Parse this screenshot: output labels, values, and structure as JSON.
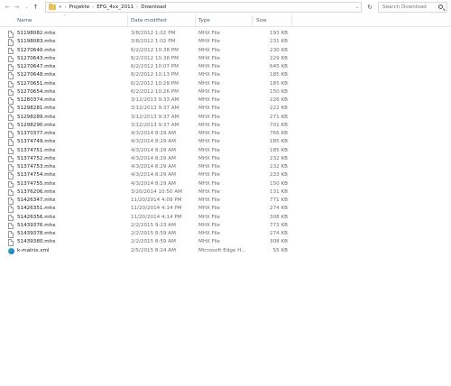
{
  "toolbar": {
    "back_icon": "arrow-left-icon",
    "forward_icon": "arrow-right-icon",
    "recent_icon": "chevron-down-icon",
    "up_icon": "arrow-up-icon",
    "breadcrumb": {
      "overflow": "«",
      "items": [
        "Projekte",
        "EFG_4xx_2011",
        "Download"
      ]
    },
    "refresh_icon": "refresh-icon",
    "search_placeholder": "Search Download"
  },
  "columns": {
    "name": "Name",
    "date": "Date modified",
    "type": "Type",
    "size": "Size"
  },
  "files": [
    {
      "name": "51198082.mhx",
      "date": "3/8/2012 1:02 PM",
      "type": "MHX File",
      "size": "193 KB",
      "icon": "file-icon"
    },
    {
      "name": "51198083.mhx",
      "date": "3/8/2012 1:02 PM",
      "type": "MHX File",
      "size": "231 KB",
      "icon": "file-icon"
    },
    {
      "name": "51270640.mhx",
      "date": "6/2/2012 10:38 PM",
      "type": "MHX File",
      "size": "230 KB",
      "icon": "file-icon"
    },
    {
      "name": "51270643.mhx",
      "date": "6/2/2012 10:38 PM",
      "type": "MHX File",
      "size": "229 KB",
      "icon": "file-icon"
    },
    {
      "name": "51270647.mhx",
      "date": "6/2/2012 10:07 PM",
      "type": "MHX File",
      "size": "645 KB",
      "icon": "file-icon"
    },
    {
      "name": "51270648.mhx",
      "date": "6/2/2012 10:13 PM",
      "type": "MHX File",
      "size": "185 KB",
      "icon": "file-icon"
    },
    {
      "name": "51270651.mhx",
      "date": "6/2/2012 10:28 PM",
      "type": "MHX File",
      "size": "185 KB",
      "icon": "file-icon"
    },
    {
      "name": "51270654.mhx",
      "date": "6/2/2012 10:26 PM",
      "type": "MHX File",
      "size": "150 KB",
      "icon": "file-icon"
    },
    {
      "name": "51280374.mhx",
      "date": "3/12/2013 9:33 AM",
      "type": "MHX File",
      "size": "226 KB",
      "icon": "file-icon"
    },
    {
      "name": "51298281.mhx",
      "date": "3/12/2013 9:37 AM",
      "type": "MHX File",
      "size": "222 KB",
      "icon": "file-icon"
    },
    {
      "name": "51298289.mhx",
      "date": "3/12/2013 9:37 AM",
      "type": "MHX File",
      "size": "271 KB",
      "icon": "file-icon"
    },
    {
      "name": "51298290.mhx",
      "date": "3/12/2013 9:37 AM",
      "type": "MHX File",
      "size": "701 KB",
      "icon": "file-icon"
    },
    {
      "name": "51370377.mhx",
      "date": "4/3/2014 8:29 AM",
      "type": "MHX File",
      "size": "766 KB",
      "icon": "file-icon"
    },
    {
      "name": "51374749.mhx",
      "date": "4/3/2014 8:29 AM",
      "type": "MHX File",
      "size": "185 KB",
      "icon": "file-icon"
    },
    {
      "name": "51374751.mhx",
      "date": "4/3/2014 8:29 AM",
      "type": "MHX File",
      "size": "185 KB",
      "icon": "file-icon"
    },
    {
      "name": "51374752.mhx",
      "date": "4/3/2014 8:29 AM",
      "type": "MHX File",
      "size": "232 KB",
      "icon": "file-icon"
    },
    {
      "name": "51374753.mhx",
      "date": "4/3/2014 8:29 AM",
      "type": "MHX File",
      "size": "232 KB",
      "icon": "file-icon"
    },
    {
      "name": "51374754.mhx",
      "date": "4/3/2014 8:29 AM",
      "type": "MHX File",
      "size": "233 KB",
      "icon": "file-icon"
    },
    {
      "name": "51374755.mhx",
      "date": "4/3/2014 8:29 AM",
      "type": "MHX File",
      "size": "150 KB",
      "icon": "file-icon"
    },
    {
      "name": "51376206.mhx",
      "date": "3/20/2014 10:50 AM",
      "type": "MHX File",
      "size": "131 KB",
      "icon": "file-icon"
    },
    {
      "name": "51426347.mhx",
      "date": "11/20/2014 4:09 PM",
      "type": "MHX File",
      "size": "771 KB",
      "icon": "file-icon"
    },
    {
      "name": "51426351.mhx",
      "date": "11/20/2014 4:14 PM",
      "type": "MHX File",
      "size": "274 KB",
      "icon": "file-icon"
    },
    {
      "name": "51426356.mhx",
      "date": "11/20/2014 4:14 PM",
      "type": "MHX File",
      "size": "308 KB",
      "icon": "file-icon"
    },
    {
      "name": "51439376.mhx",
      "date": "2/2/2015 9:23 AM",
      "type": "MHX File",
      "size": "773 KB",
      "icon": "file-icon"
    },
    {
      "name": "51439378.mhx",
      "date": "2/2/2015 8:59 AM",
      "type": "MHX File",
      "size": "274 KB",
      "icon": "file-icon"
    },
    {
      "name": "51439380.mhx",
      "date": "2/2/2015 8:59 AM",
      "type": "MHX File",
      "size": "308 KB",
      "icon": "file-icon"
    },
    {
      "name": "k-matrix.xml",
      "date": "2/5/2015 8:24 AM",
      "type": "Microsoft Edge H...",
      "size": "55 KB",
      "icon": "edge-icon"
    }
  ]
}
